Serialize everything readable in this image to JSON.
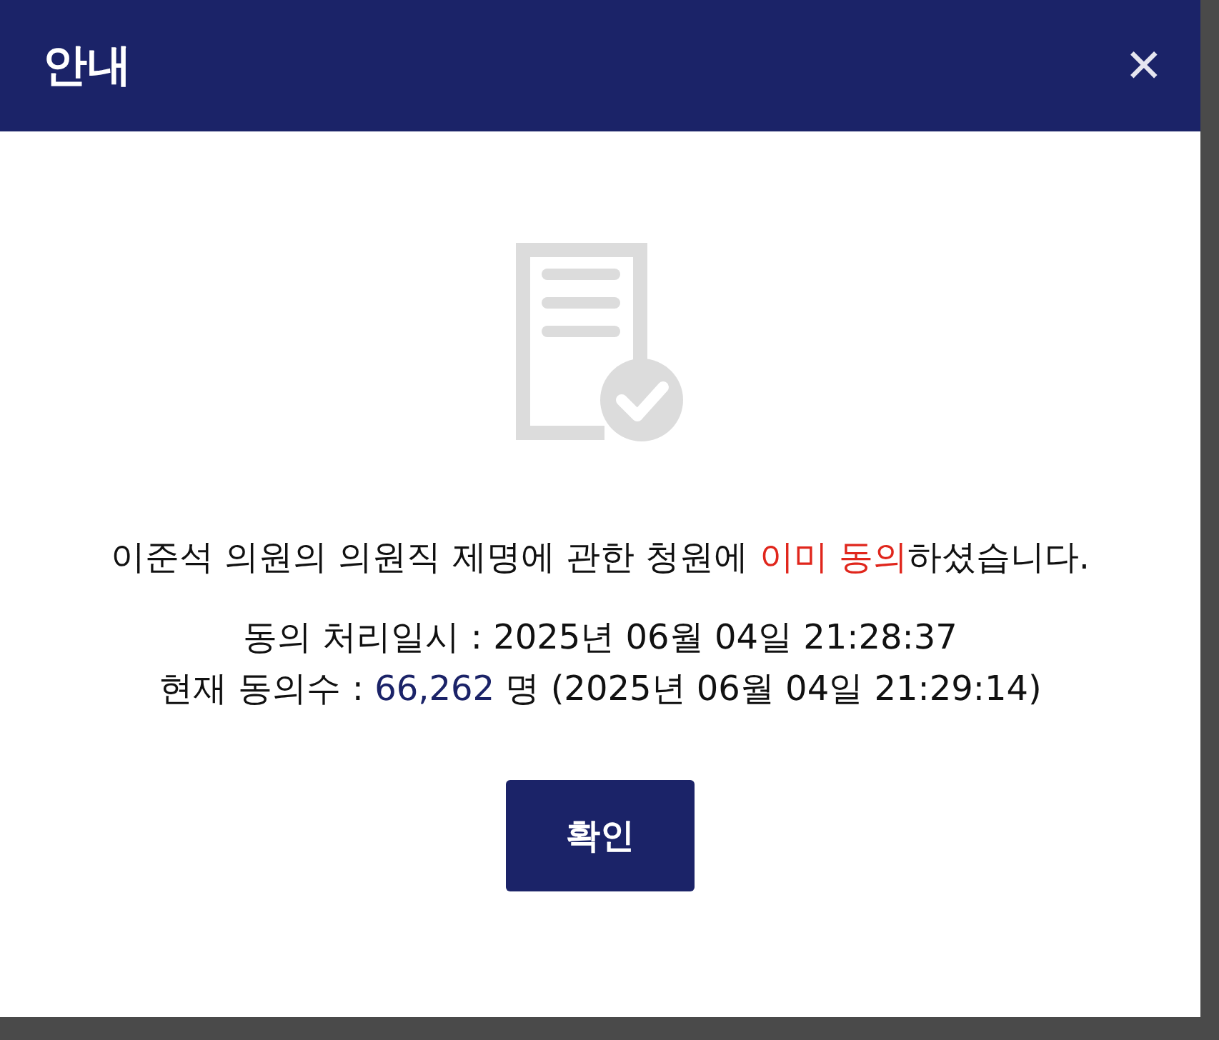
{
  "dialog": {
    "title": "안내",
    "close_glyph": "✕"
  },
  "message": {
    "before": "이준석 의원의 의원직 제명에 관한 청원에 ",
    "highlight": "이미 동의",
    "after": "하셨습니다."
  },
  "processed": {
    "label": "동의 처리일시 : ",
    "value": "2025년 06월 04일 21:28:37"
  },
  "count": {
    "label": "현재 동의수 : ",
    "number": "66,262",
    "after": " 명 (2025년 06월 04일 21:29:14)"
  },
  "confirm_button": "확인"
}
